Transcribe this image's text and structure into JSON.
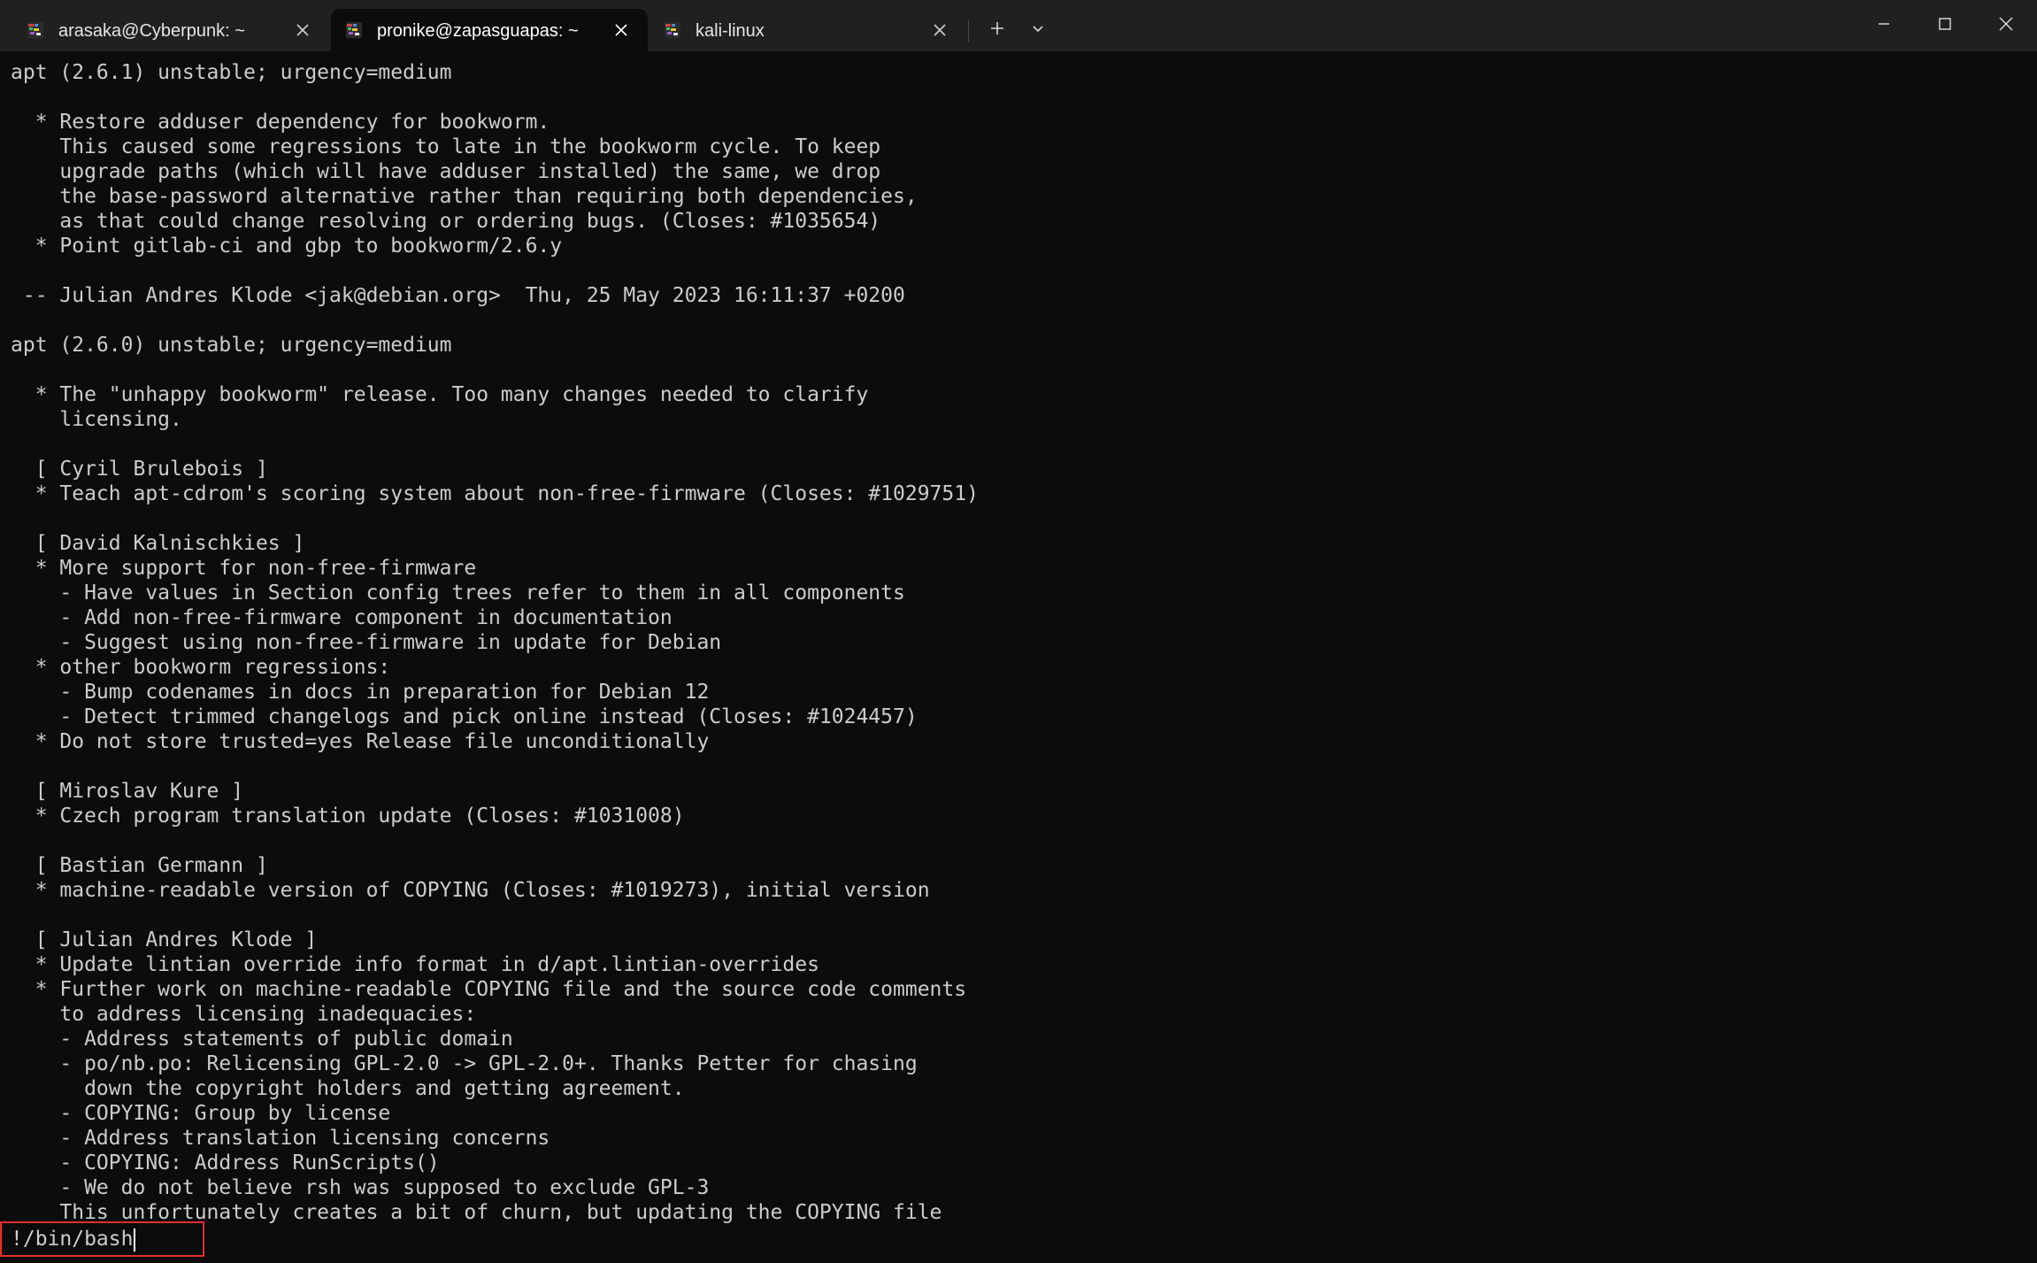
{
  "window": {
    "tabs": [
      {
        "label": "arasaka@Cyberpunk: ~",
        "active": false,
        "icon": "linux-penguin-icon"
      },
      {
        "label": "pronike@zapasguapas: ~",
        "active": true,
        "icon": "linux-penguin-icon"
      },
      {
        "label": "kali-linux",
        "active": false,
        "icon": "linux-penguin-icon"
      }
    ],
    "new_tab_icon": "plus-icon",
    "dropdown_icon": "chevron-down-icon",
    "controls": [
      "minimize-icon",
      "maximize-icon",
      "close-icon"
    ]
  },
  "colors": {
    "terminal_background": "#0c0c0c",
    "titlebar_background": "#202020",
    "text": "#cccccc",
    "highlight_border": "#e03030"
  },
  "terminal": {
    "lines": [
      "apt (2.6.1) unstable; urgency=medium",
      "",
      "  * Restore adduser dependency for bookworm.",
      "    This caused some regressions to late in the bookworm cycle. To keep",
      "    upgrade paths (which will have adduser installed) the same, we drop",
      "    the base-password alternative rather than requiring both dependencies,",
      "    as that could change resolving or ordering bugs. (Closes: #1035654)",
      "  * Point gitlab-ci and gbp to bookworm/2.6.y",
      "",
      " -- Julian Andres Klode <jak@debian.org>  Thu, 25 May 2023 16:11:37 +0200",
      "",
      "apt (2.6.0) unstable; urgency=medium",
      "",
      "  * The \"unhappy bookworm\" release. Too many changes needed to clarify",
      "    licensing.",
      "",
      "  [ Cyril Brulebois ]",
      "  * Teach apt-cdrom's scoring system about non-free-firmware (Closes: #1029751)",
      "",
      "  [ David Kalnischkies ]",
      "  * More support for non-free-firmware",
      "    - Have values in Section config trees refer to them in all components",
      "    - Add non-free-firmware component in documentation",
      "    - Suggest using non-free-firmware in update for Debian",
      "  * other bookworm regressions:",
      "    - Bump codenames in docs in preparation for Debian 12",
      "    - Detect trimmed changelogs and pick online instead (Closes: #1024457)",
      "  * Do not store trusted=yes Release file unconditionally",
      "",
      "  [ Miroslav Kure ]",
      "  * Czech program translation update (Closes: #1031008)",
      "",
      "  [ Bastian Germann ]",
      "  * machine-readable version of COPYING (Closes: #1019273), initial version",
      "",
      "  [ Julian Andres Klode ]",
      "  * Update lintian override info format in d/apt.lintian-overrides",
      "  * Further work on machine-readable COPYING file and the source code comments",
      "    to address licensing inadequacies:",
      "    - Address statements of public domain",
      "    - po/nb.po: Relicensing GPL-2.0 -> GPL-2.0+. Thanks Petter for chasing",
      "      down the copyright holders and getting agreement.",
      "    - COPYING: Group by license",
      "    - Address translation licensing concerns",
      "    - COPYING: Address RunScripts()",
      "    - We do not believe rsh was supposed to exclude GPL-3",
      "    This unfortunately creates a bit of churn, but updating the COPYING file"
    ],
    "prompt_input": "!/bin/bash"
  }
}
